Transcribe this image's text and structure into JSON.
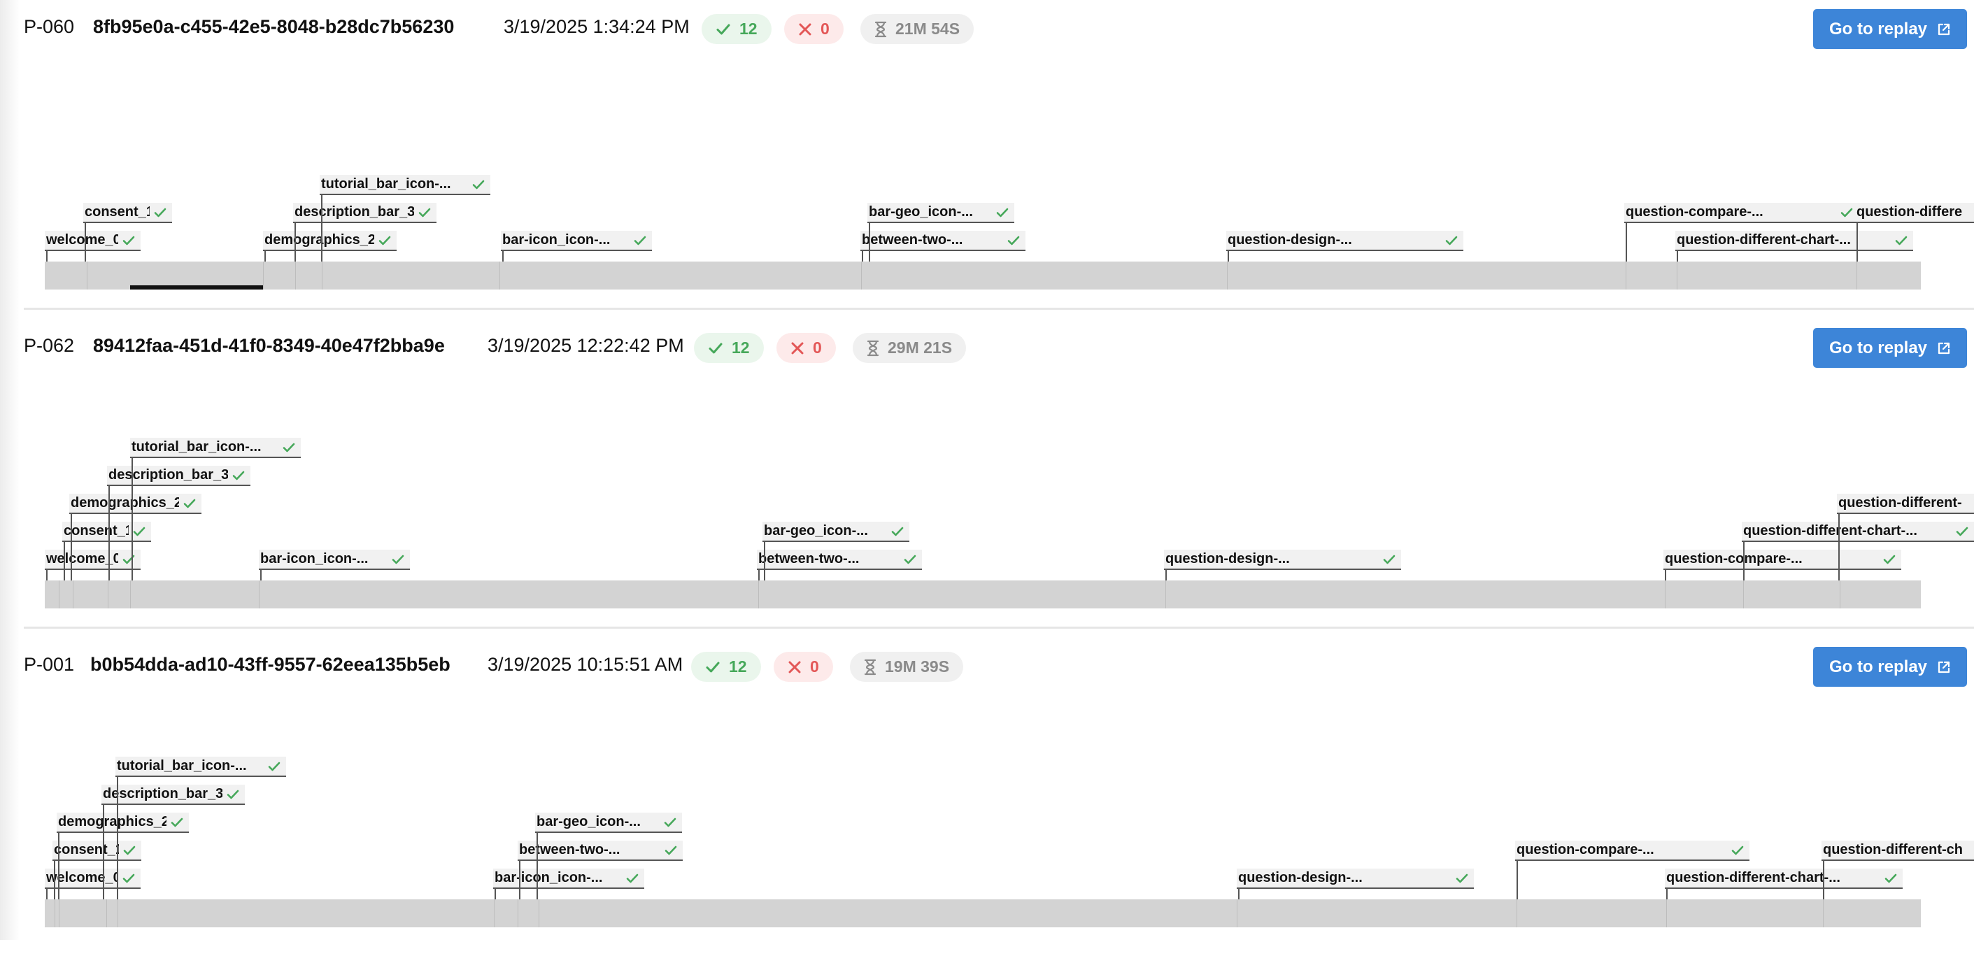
{
  "buttons": {
    "replay_label": "Go to replay"
  },
  "icons": {
    "check": "check-icon",
    "cross": "x-icon",
    "duration": "hourglass-icon",
    "external": "external-link-icon"
  },
  "colors": {
    "accent": "#3d85d8",
    "success": "#46a85a",
    "error": "#e35757",
    "muted": "#8a8a8a",
    "track": "#d3d3d3"
  },
  "sessions": [
    {
      "participant": "P-060",
      "session_id": "8fb95e0a-c455-42e5-8048-b28dc7b56230",
      "datetime": "3/19/2025 1:34:24 PM",
      "completed": "12",
      "failed": "0",
      "duration": "21M 54S",
      "steps": [
        {
          "label": "welcome_0"
        },
        {
          "label": "consent_1"
        },
        {
          "label": "demographics_2"
        },
        {
          "label": "description_bar_3"
        },
        {
          "label": "tutorial_bar_icon-..."
        },
        {
          "label": "bar-icon_icon-..."
        },
        {
          "label": "between-two-..."
        },
        {
          "label": "bar-geo_icon-..."
        },
        {
          "label": "question-design-..."
        },
        {
          "label": "question-compare-..."
        },
        {
          "label": "question-different-chart-..."
        },
        {
          "label": "question-differe"
        }
      ]
    },
    {
      "participant": "P-062",
      "session_id": "89412faa-451d-41f0-8349-40e47f2bba9e",
      "datetime": "3/19/2025 12:22:42 PM",
      "completed": "12",
      "failed": "0",
      "duration": "29M 21S",
      "steps": [
        {
          "label": "welcome_0"
        },
        {
          "label": "consent_1"
        },
        {
          "label": "demographics_2"
        },
        {
          "label": "description_bar_3"
        },
        {
          "label": "tutorial_bar_icon-..."
        },
        {
          "label": "bar-icon_icon-..."
        },
        {
          "label": "between-two-..."
        },
        {
          "label": "bar-geo_icon-..."
        },
        {
          "label": "question-design-..."
        },
        {
          "label": "question-compare-..."
        },
        {
          "label": "question-different-chart-..."
        },
        {
          "label": "question-different-"
        }
      ]
    },
    {
      "participant": "P-001",
      "session_id": "b0b54dda-ad10-43ff-9557-62eea135b5eb",
      "datetime": "3/19/2025 10:15:51 AM",
      "completed": "12",
      "failed": "0",
      "duration": "19M 39S",
      "steps": [
        {
          "label": "welcome_0"
        },
        {
          "label": "consent_1"
        },
        {
          "label": "demographics_2"
        },
        {
          "label": "description_bar_3"
        },
        {
          "label": "tutorial_bar_icon-..."
        },
        {
          "label": "bar-icon_icon-..."
        },
        {
          "label": "between-two-..."
        },
        {
          "label": "bar-geo_icon-..."
        },
        {
          "label": "question-design-..."
        },
        {
          "label": "question-compare-..."
        },
        {
          "label": "question-different-chart-..."
        },
        {
          "label": "question-different-ch"
        }
      ]
    }
  ]
}
